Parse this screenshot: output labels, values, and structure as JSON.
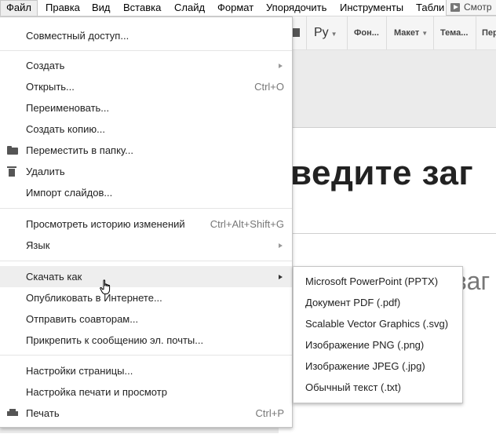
{
  "menubar": {
    "items": [
      {
        "label": "Файл",
        "active": true
      },
      {
        "label": "Правка"
      },
      {
        "label": "Вид"
      },
      {
        "label": "Вставка"
      },
      {
        "label": "Слайд"
      },
      {
        "label": "Формат"
      },
      {
        "label": "Упорядочить"
      },
      {
        "label": "Инструменты"
      },
      {
        "label": "Табли"
      }
    ],
    "present_label": "Смотр"
  },
  "toolbar": {
    "font_label": "Ру",
    "background_label": "Фон...",
    "layout_label": "Макет",
    "theme_label": "Тема...",
    "transition_label": "Пер"
  },
  "slide": {
    "title_partial": "ведите заг",
    "subtitle_partial": "заг"
  },
  "file_menu": {
    "share": "Совместный доступ...",
    "create": "Создать",
    "open": "Открыть...",
    "open_shortcut": "Ctrl+O",
    "rename": "Переименовать...",
    "copy": "Создать копию...",
    "move": "Переместить в папку...",
    "delete": "Удалить",
    "import": "Импорт слайдов...",
    "history": "Просмотреть историю изменений",
    "history_shortcut": "Ctrl+Alt+Shift+G",
    "language": "Язык",
    "download": "Скачать как",
    "publish": "Опубликовать в Интернете...",
    "email_collaborators": "Отправить соавторам...",
    "email_attach": "Прикрепить к сообщению эл. почты...",
    "page_setup": "Настройки страницы...",
    "print_settings": "Настройка печати и просмотр",
    "print": "Печать",
    "print_shortcut": "Ctrl+P"
  },
  "download_submenu": {
    "items": [
      "Microsoft PowerPoint (PPTX)",
      "Документ PDF (.pdf)",
      "Scalable Vector Graphics (.svg)",
      "Изображение PNG (.png)",
      "Изображение JPEG (.jpg)",
      "Обычный текст (.txt)"
    ]
  },
  "icons": [
    "folder-icon",
    "trash-icon",
    "printer-icon",
    "play-icon",
    "cursor-hand-icon"
  ]
}
